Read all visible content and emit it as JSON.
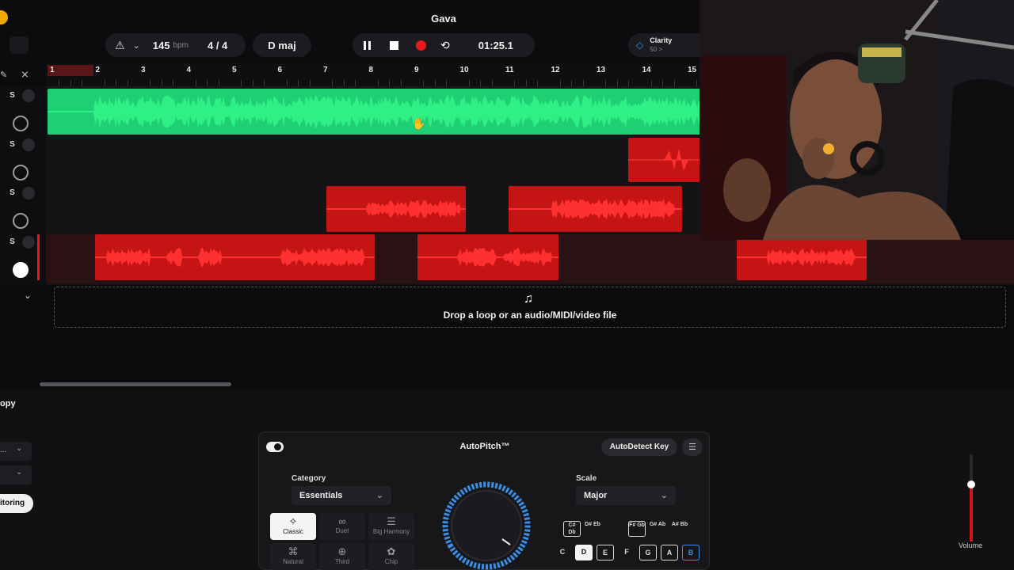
{
  "header": {
    "title": "Gava",
    "bpm_value": "145",
    "bpm_unit": "bpm",
    "time_sig": "4 / 4",
    "key": "D maj",
    "time_display": "01:25.1",
    "clarity_label": "Clarity",
    "clarity_value": "50 >"
  },
  "ruler": {
    "bars": [
      "1",
      "2",
      "3",
      "4",
      "5",
      "6",
      "7",
      "8",
      "9",
      "10",
      "11",
      "12",
      "13",
      "14",
      "15"
    ]
  },
  "tracks": [
    {
      "solo": "S",
      "color": "#1fcf74"
    },
    {
      "solo": "S",
      "color": "#c41414"
    },
    {
      "solo": "S",
      "color": "#c41414"
    },
    {
      "solo": "S",
      "color": "#c41414"
    }
  ],
  "dropzone": {
    "label": "Drop a loop or an audio/MIDI/video file"
  },
  "left_panel": {
    "title": "opy",
    "dropdown1": "...",
    "monitoring_label": "itoring"
  },
  "autopitch": {
    "title": "AutoPitch™",
    "autodetect_label": "AutoDetect Key",
    "category_label": "Category",
    "category_value": "Essentials",
    "scale_label": "Scale",
    "scale_value": "Major",
    "categories": [
      "Classic",
      "Duet",
      "Big Harmony",
      "Natural",
      "Third",
      "Chip"
    ],
    "keys_top": [
      "C# Db",
      "D# Eb",
      "F# Gb",
      "G# Ab",
      "A# Bb"
    ],
    "keys_bottom": [
      "C",
      "D",
      "E",
      "F",
      "G",
      "A",
      "B"
    ]
  },
  "volume": {
    "label": "Volume",
    "level": 0.7
  },
  "colors": {
    "green_track": "#1fcf74",
    "red_track": "#c41414",
    "record": "#e51b1b",
    "accent_blue": "#3a8ee6"
  }
}
